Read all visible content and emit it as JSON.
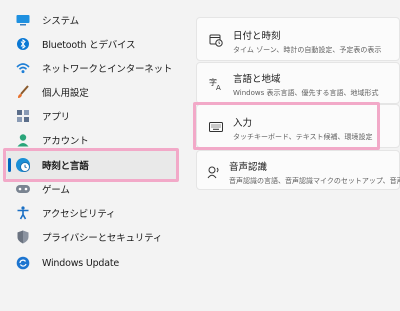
{
  "sidebar": {
    "items": [
      {
        "label": "システム",
        "icon": "monitor-icon"
      },
      {
        "label": "Bluetooth とデバイス",
        "icon": "bluetooth-icon"
      },
      {
        "label": "ネットワークとインターネット",
        "icon": "wifi-icon"
      },
      {
        "label": "個人用設定",
        "icon": "brush-icon"
      },
      {
        "label": "アプリ",
        "icon": "apps-icon"
      },
      {
        "label": "アカウント",
        "icon": "person-icon"
      },
      {
        "label": "時刻と言語",
        "icon": "globe-clock-icon",
        "selected": true
      },
      {
        "label": "ゲーム",
        "icon": "gamepad-icon"
      },
      {
        "label": "アクセシビリティ",
        "icon": "accessibility-icon"
      },
      {
        "label": "プライバシーとセキュリティ",
        "icon": "shield-icon"
      },
      {
        "label": "Windows Update",
        "icon": "update-icon"
      }
    ]
  },
  "cards": [
    {
      "title": "日付と時刻",
      "subtitle": "タイム ゾーン、時計の自動設定、予定表の表示",
      "icon": "calendar-clock-icon"
    },
    {
      "title": "言語と地域",
      "subtitle": "Windows 表示言語、優先する言語、地域形式",
      "icon": "language-icon"
    },
    {
      "title": "入力",
      "subtitle": "タッチキーボード、テキスト候補、環境設定",
      "icon": "keyboard-icon"
    },
    {
      "title": "音声認識",
      "subtitle": "音声認識の言語、音声認識マイクのセットアップ、音声",
      "icon": "speech-icon"
    }
  ],
  "colors": {
    "accent": "#0067c0",
    "highlight": "#f2a9c8"
  }
}
